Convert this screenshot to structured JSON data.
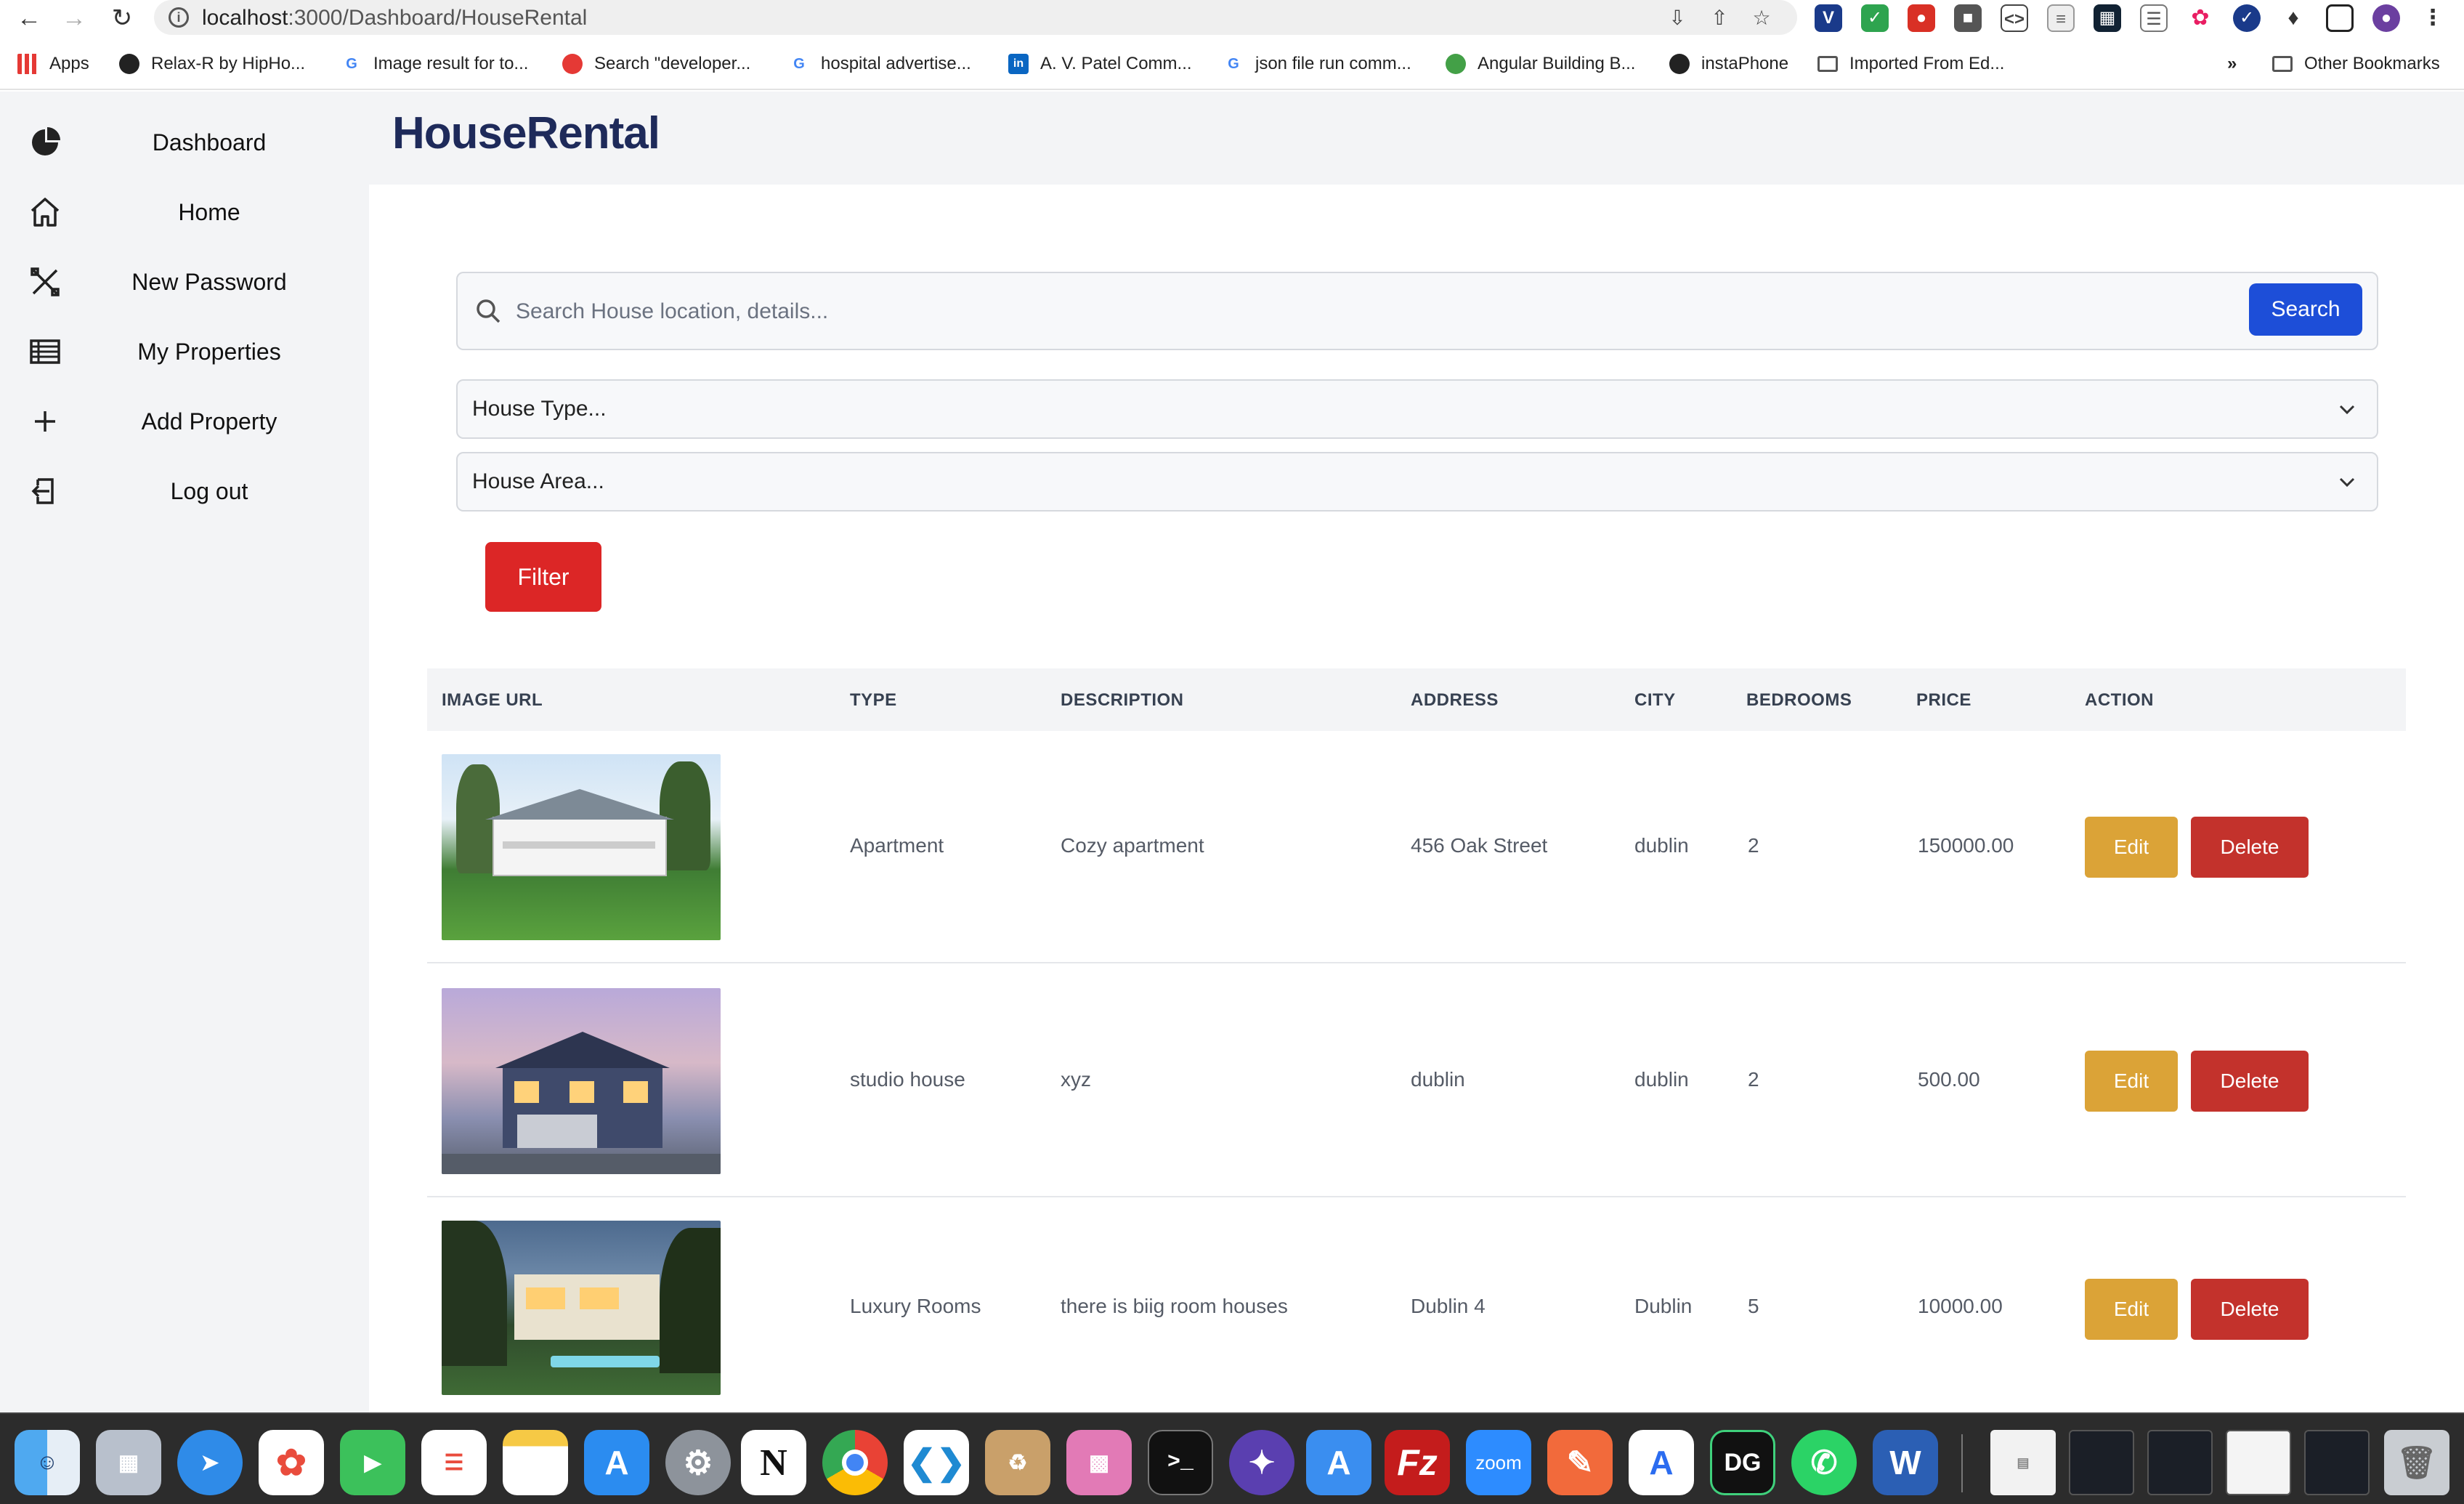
{
  "browser": {
    "url_host": "localhost",
    "url_path": ":3000/Dashboard/HouseRental",
    "bookmarks": [
      {
        "label": "Apps",
        "icon": "apps-grid-icon",
        "color": "#4285f4"
      },
      {
        "label": "Relax-R  by HipHo...",
        "icon": "site-icon",
        "color": "#222222"
      },
      {
        "label": "Image result for to...",
        "icon": "google-icon",
        "color": "#4285f4"
      },
      {
        "label": "Search \"developer...",
        "icon": "site-icon",
        "color": "#e53935"
      },
      {
        "label": "hospital advertise...",
        "icon": "google-icon",
        "color": "#4285f4"
      },
      {
        "label": "A. V. Patel Comm...",
        "icon": "linkedin-icon",
        "color": "#0a66c2"
      },
      {
        "label": "json file run comm...",
        "icon": "google-icon",
        "color": "#4285f4"
      },
      {
        "label": "Angular Building B...",
        "icon": "site-icon",
        "color": "#43a047"
      },
      {
        "label": "instaPhone",
        "icon": "site-icon",
        "color": "#222222"
      },
      {
        "label": "Imported From Ed...",
        "icon": "folder-icon",
        "color": "#555555"
      }
    ],
    "bookmarks_overflow": "»",
    "other_bookmarks": "Other Bookmarks"
  },
  "sidebar": {
    "items": [
      {
        "label": "Dashboard",
        "icon": "pie-chart-icon"
      },
      {
        "label": "Home",
        "icon": "home-icon"
      },
      {
        "label": "New Password",
        "icon": "tools-icon"
      },
      {
        "label": "My Properties",
        "icon": "table-list-icon"
      },
      {
        "label": "Add Property",
        "icon": "plus-icon"
      },
      {
        "label": "Log out",
        "icon": "logout-icon"
      }
    ]
  },
  "header": {
    "brand": "HouseRental"
  },
  "search": {
    "placeholder": "Search House location, details...",
    "button": "Search"
  },
  "filters": {
    "house_type": "House Type...",
    "house_area": "House Area...",
    "button": "Filter"
  },
  "table": {
    "headers": [
      "IMAGE URL",
      "TYPE",
      "DESCRIPTION",
      "ADDRESS",
      "CITY",
      "BEDROOMS",
      "PRICE",
      "ACTION"
    ],
    "rows": [
      {
        "image": "white-farmhouse-photo",
        "type": "Apartment",
        "description": "Cozy apartment",
        "address": "456 Oak Street",
        "city": "dublin",
        "bedrooms": "2",
        "price": "150000.00",
        "edit": "Edit",
        "delete": "Delete"
      },
      {
        "image": "blue-suburban-house-photo",
        "type": "studio house",
        "description": "xyz",
        "address": "dublin",
        "city": "dublin",
        "bedrooms": "2",
        "price": "500.00",
        "edit": "Edit",
        "delete": "Delete"
      },
      {
        "image": "modern-villa-evening-photo",
        "type": "Luxury Rooms",
        "description": "there is biig room houses",
        "address": "Dublin 4",
        "city": "Dublin",
        "bedrooms": "5",
        "price": "10000.00",
        "edit": "Edit",
        "delete": "Delete"
      }
    ]
  },
  "colors": {
    "brand": "#1e2a5a",
    "search_button": "#1d4ed8",
    "filter_button": "#dc2626",
    "edit_button": "#dba337",
    "delete_button": "#c3322c",
    "sidebar_bg": "#f3f4f6"
  },
  "dock": {
    "apps": [
      "finder",
      "launchpad",
      "safari",
      "photos",
      "facetime",
      "reminders",
      "notes",
      "app-store",
      "system-preferences",
      "notion",
      "chrome",
      "vscode",
      "archive",
      "mirror",
      "terminal",
      "spotlight",
      "xcode-tools",
      "filezilla",
      "zoom",
      "pen-tool",
      "instruments",
      "datagrip",
      "whatsapp",
      "word",
      "document",
      "window-1",
      "window-2",
      "window-3",
      "window-4",
      "trash"
    ],
    "zoom_label": "zoom",
    "datagrip_label": "DG",
    "filezilla_label": "Fz",
    "word_label": "W",
    "notion_label": "N"
  }
}
